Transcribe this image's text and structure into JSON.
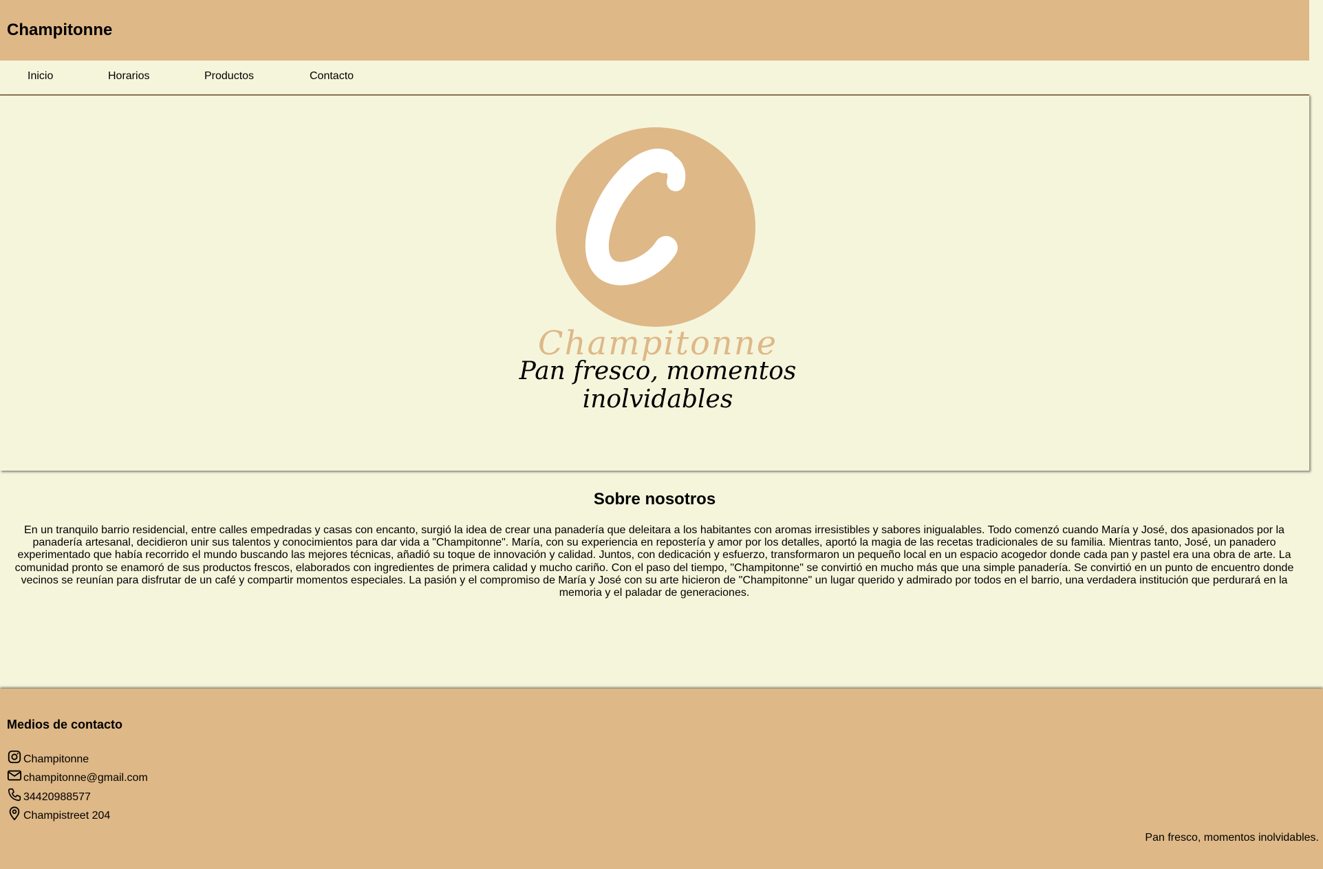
{
  "header": {
    "title": "Champitonne"
  },
  "nav": {
    "items": [
      {
        "label": "Inicio"
      },
      {
        "label": "Horarios"
      },
      {
        "label": "Productos"
      },
      {
        "label": "Contacto"
      }
    ]
  },
  "hero": {
    "logo_letter": "C",
    "logo_name": "Champitonne",
    "tagline": "Pan fresco, momentos inolvidables"
  },
  "about": {
    "title": "Sobre nosotros",
    "text": "En un tranquilo barrio residencial, entre calles empedradas y casas con encanto, surgió la idea de crear una panadería que deleitara a los habitantes con aromas irresistibles y sabores inigualables. Todo comenzó cuando María y José, dos apasionados por la panadería artesanal, decidieron unir sus talentos y conocimientos para dar vida a \"Champitonne\". María, con su experiencia en repostería y amor por los detalles, aportó la magia de las recetas tradicionales de su familia. Mientras tanto, José, un panadero experimentado que había recorrido el mundo buscando las mejores técnicas, añadió su toque de innovación y calidad. Juntos, con dedicación y esfuerzo, transformaron un pequeño local en un espacio acogedor donde cada pan y pastel era una obra de arte. La comunidad pronto se enamoró de sus productos frescos, elaborados con ingredientes de primera calidad y mucho cariño. Con el paso del tiempo, \"Champitonne\" se convirtió en mucho más que una simple panadería. Se convirtió en un punto de encuentro donde vecinos se reunían para disfrutar de un café y compartir momentos especiales. La pasión y el compromiso de María y José con su arte hicieron de \"Champitonne\" un lugar querido y admirado por todos en el barrio, una verdadera institución que perdurará en la memoria y el paladar de generaciones."
  },
  "footer": {
    "title": "Medios de contacto",
    "contacts": [
      {
        "icon": "instagram-icon",
        "text": "Champitonne"
      },
      {
        "icon": "mail-icon",
        "text": "champitonne@gmail.com"
      },
      {
        "icon": "phone-icon",
        "text": "34420988577"
      },
      {
        "icon": "location-pin-icon",
        "text": "Champistreet 204"
      }
    ],
    "tagline": "Pan fresco, momentos inolvidables."
  },
  "colors": {
    "accent": "#deb887",
    "background": "#f5f5dc"
  }
}
